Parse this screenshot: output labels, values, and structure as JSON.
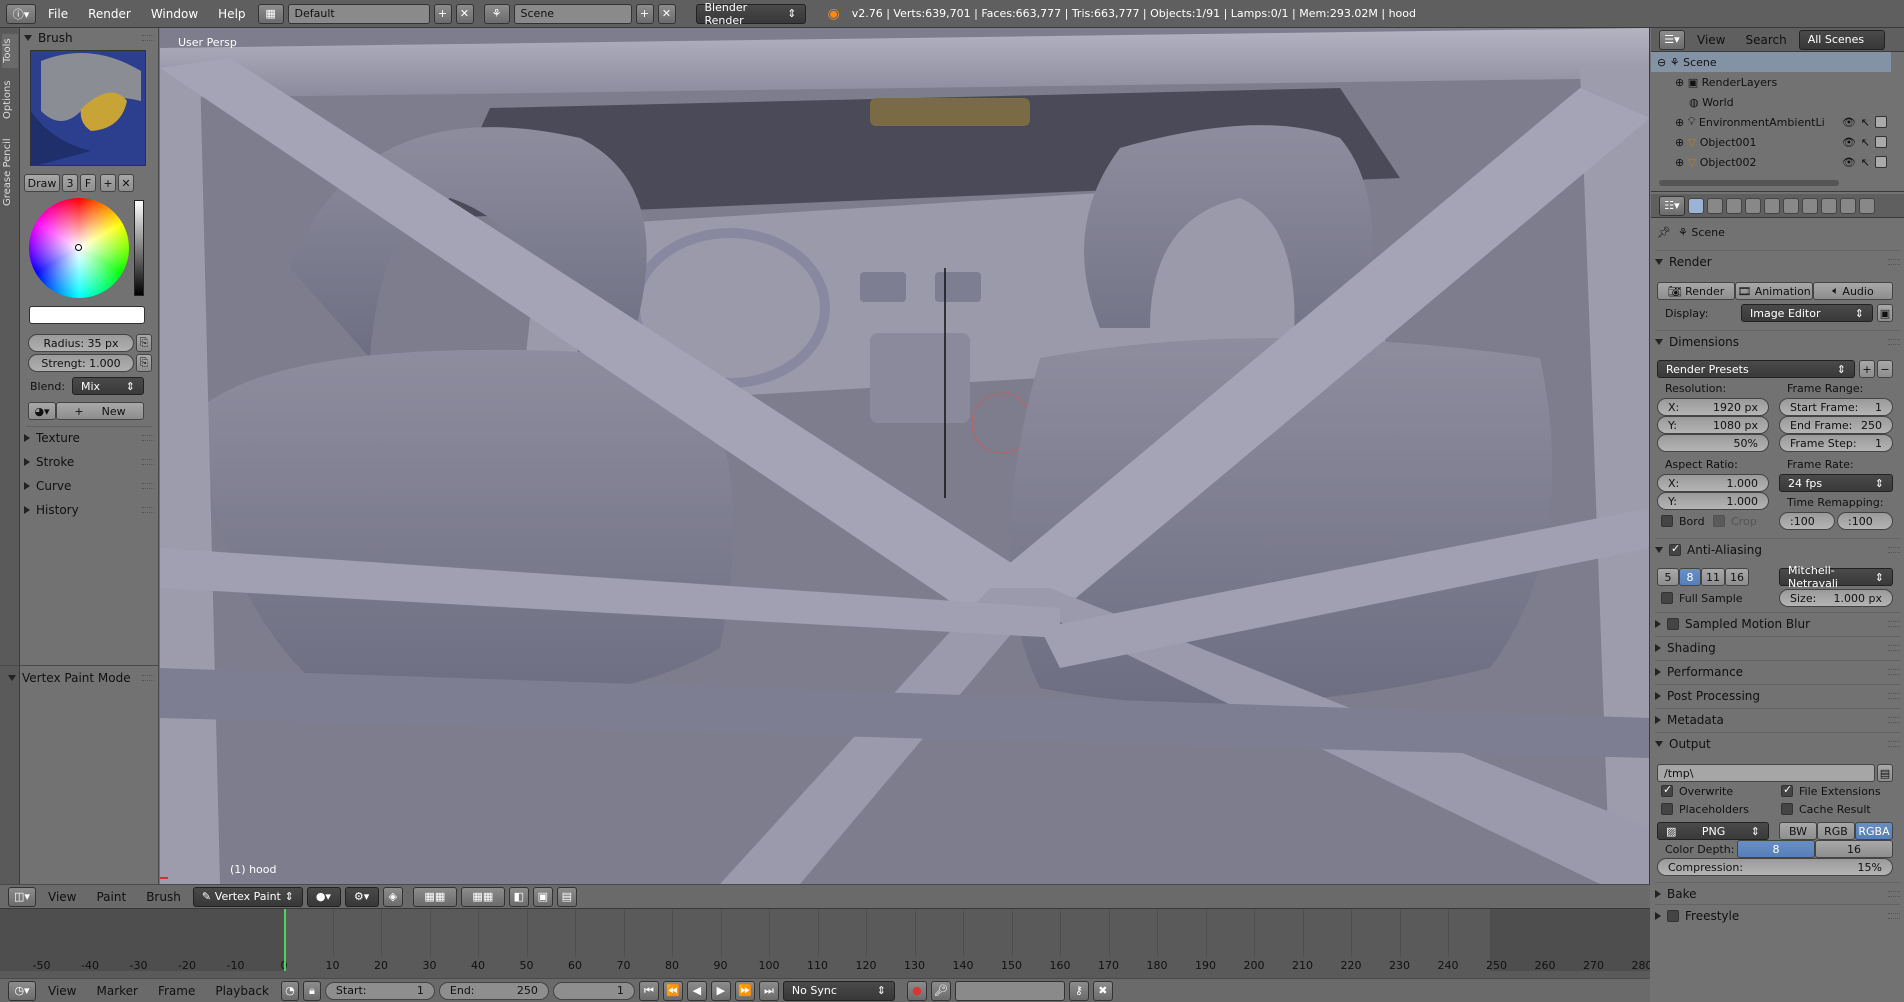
{
  "topbar": {
    "menus": [
      "File",
      "Render",
      "Window",
      "Help"
    ],
    "screen_layout": "Default",
    "scene": "Scene",
    "engine": "Blender Render",
    "stats": "v2.76 | Verts:639,701 | Faces:663,777 | Tris:663,777 | Objects:1/91 | Lamps:0/1 | Mem:293.02M | hood"
  },
  "leftstrip": {
    "tabs": [
      "Tools",
      "Options",
      "Grease Pencil"
    ]
  },
  "brush": {
    "header": "Brush",
    "mode_label": "Draw",
    "users": "3",
    "fake_user": "F",
    "radius": "Radius:  35 px",
    "strength": "Strengt: 1.000",
    "blend_label": "Blend:",
    "blend_value": "Mix",
    "new_label": "New",
    "sections": [
      "Texture",
      "Stroke",
      "Curve",
      "History"
    ],
    "mode_panel": "Vertex Paint Mode"
  },
  "viewport": {
    "label": "User Persp",
    "object_label": "(1) hood",
    "colors": {
      "bg": "#3e3e48",
      "mesh": "#9a9aab",
      "mesh_dark": "#6c6c80",
      "cage": "#a9a9b8"
    }
  },
  "viewport_header": {
    "menus": [
      "View",
      "Paint",
      "Brush"
    ],
    "mode": "Vertex Paint"
  },
  "timeline": {
    "ticks": [
      "-50",
      "-40",
      "-30",
      "-20",
      "-10",
      "0",
      "10",
      "20",
      "30",
      "40",
      "50",
      "60",
      "70",
      "80",
      "90",
      "100",
      "110",
      "120",
      "130",
      "140",
      "150",
      "160",
      "170",
      "180",
      "190",
      "200",
      "210",
      "220",
      "230",
      "240",
      "250",
      "260",
      "270",
      "280"
    ],
    "current_frame_marker": 1
  },
  "timeline_header": {
    "menus": [
      "View",
      "Marker",
      "Frame",
      "Playback"
    ],
    "start_label": "Start:",
    "start_value": "1",
    "end_label": "End:",
    "end_value": "250",
    "current": "1",
    "sync": "No Sync"
  },
  "outliner": {
    "menus": [
      "View",
      "Search"
    ],
    "scope": "All Scenes",
    "rows": [
      {
        "name": "Scene",
        "indent": 0
      },
      {
        "name": "RenderLayers",
        "indent": 1
      },
      {
        "name": "World",
        "indent": 1
      },
      {
        "name": "EnvironmentAmbientLi",
        "indent": 1
      },
      {
        "name": "Object001",
        "indent": 1
      },
      {
        "name": "Object002",
        "indent": 1
      }
    ]
  },
  "props": {
    "context": "Scene",
    "render": {
      "header": "Render",
      "render_btn": "Render",
      "animation_btn": "Animation",
      "audio_btn": "Audio",
      "display_label": "Display:",
      "display_value": "Image Editor"
    },
    "dimensions": {
      "header": "Dimensions",
      "presets": "Render Presets",
      "resolution_label": "Resolution:",
      "res_x_label": "X:",
      "res_x": "1920 px",
      "res_y_label": "Y:",
      "res_y": "1080 px",
      "res_pct": "50%",
      "frame_range_label": "Frame Range:",
      "start_label": "Start Frame:",
      "start": "1",
      "end_label": "End Frame:",
      "end": "250",
      "step_label": "Frame Step:",
      "step": "1",
      "aspect_label": "Aspect Ratio:",
      "asp_x_label": "X:",
      "asp_x": "1.000",
      "asp_y_label": "Y:",
      "asp_y": "1.000",
      "frame_rate_label": "Frame Rate:",
      "frame_rate": "24 fps",
      "time_remap_label": "Time Remapping:",
      "remap_old": ":100",
      "remap_new": ":100",
      "bord": "Bord",
      "crop": "Crop"
    },
    "aa": {
      "header": "Anti-Aliasing",
      "samples": [
        "5",
        "8",
        "11",
        "16"
      ],
      "selected": "8",
      "filter": "Mitchell-Netravali",
      "full_sample": "Full Sample",
      "size_label": "Size:",
      "size": "1.000 px"
    },
    "collapsed": [
      "Sampled Motion Blur",
      "Shading",
      "Performance",
      "Post Processing",
      "Metadata"
    ],
    "output": {
      "header": "Output",
      "path": "/tmp\\",
      "overwrite": "Overwrite",
      "file_ext": "File Extensions",
      "placeholders": "Placeholders",
      "cache_result": "Cache Result",
      "format": "PNG",
      "bw": "BW",
      "rgb": "RGB",
      "rgba": "RGBA",
      "color_depth_label": "Color Depth:",
      "depth_8": "8",
      "depth_16": "16",
      "compression_label": "Compression:",
      "compression": "15%"
    },
    "bottom_sections": [
      "Bake",
      "Freestyle"
    ]
  }
}
